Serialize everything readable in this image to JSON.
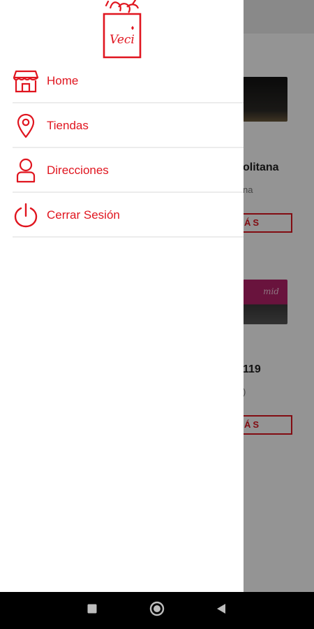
{
  "background": {
    "cards": [
      {
        "title": "olitana",
        "subtitle": "na",
        "button_label": "ÁS",
        "image_text": ""
      },
      {
        "title": "119",
        "subtitle": ")",
        "button_label": "ÁS",
        "image_text": "mid"
      }
    ]
  },
  "drawer": {
    "logo_text": "Veci",
    "menu": [
      {
        "label": "Home",
        "icon": "store-icon"
      },
      {
        "label": "Tiendas",
        "icon": "location-pin-icon"
      },
      {
        "label": "Direcciones",
        "icon": "person-icon"
      },
      {
        "label": "Cerrar Sesión",
        "icon": "power-icon"
      }
    ]
  },
  "navbar": {
    "buttons": [
      "recents-icon",
      "home-icon",
      "back-icon"
    ]
  },
  "colors": {
    "accent": "#e0151f",
    "divider": "#ececec",
    "navbar": "#000000"
  }
}
